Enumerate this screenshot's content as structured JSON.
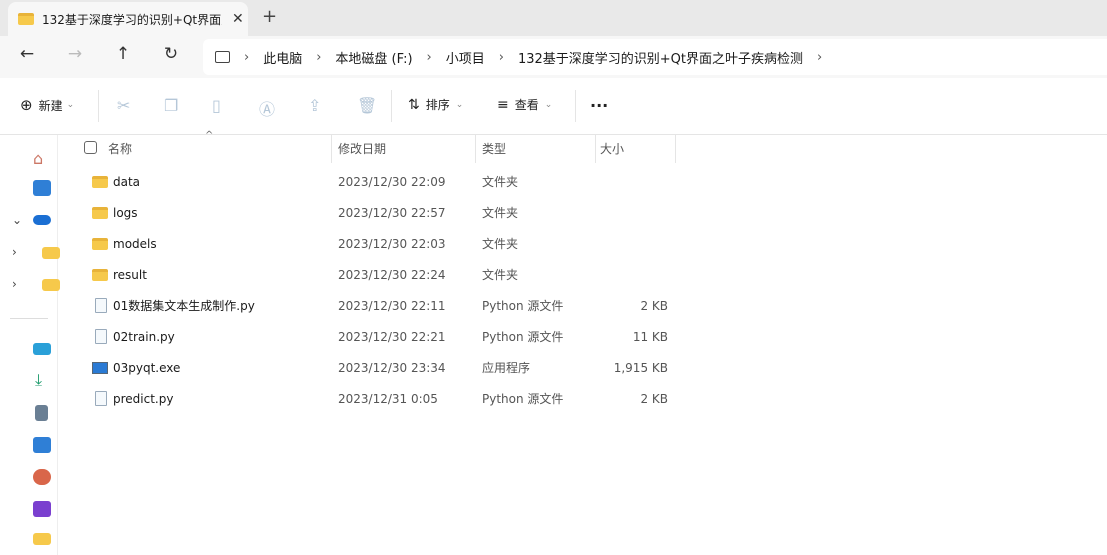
{
  "tab": {
    "title": "132基于深度学习的识别+Qt界面之叶子疾病检测",
    "close": "✕",
    "new_tab": "+"
  },
  "nav": {
    "back": "←",
    "forward": "→",
    "up": "↑",
    "refresh": "↻"
  },
  "breadcrumb": [
    "此电脑",
    "本地磁盘 (F:)",
    "小项目",
    "132基于深度学习的识别+Qt界面之叶子疾病检测"
  ],
  "toolbar": {
    "new_label": "新建",
    "sort_label": "排序",
    "view_label": "查看",
    "more": "···"
  },
  "columns": {
    "name": "名称",
    "modified": "修改日期",
    "type": "类型",
    "size": "大小"
  },
  "files": [
    {
      "name": "data",
      "modified": "2023/12/30 22:09",
      "type": "文件夹",
      "size": "",
      "icon": "folder"
    },
    {
      "name": "logs",
      "modified": "2023/12/30 22:57",
      "type": "文件夹",
      "size": "",
      "icon": "folder"
    },
    {
      "name": "models",
      "modified": "2023/12/30 22:03",
      "type": "文件夹",
      "size": "",
      "icon": "folder"
    },
    {
      "name": "result",
      "modified": "2023/12/30 22:24",
      "type": "文件夹",
      "size": "",
      "icon": "folder"
    },
    {
      "name": "01数据集文本生成制作.py",
      "modified": "2023/12/30 22:11",
      "type": "Python 源文件",
      "size": "2 KB",
      "icon": "python-file"
    },
    {
      "name": "02train.py",
      "modified": "2023/12/30 22:21",
      "type": "Python 源文件",
      "size": "11 KB",
      "icon": "python-file"
    },
    {
      "name": "03pyqt.exe",
      "modified": "2023/12/30 23:34",
      "type": "应用程序",
      "size": "1,915 KB",
      "icon": "exe"
    },
    {
      "name": "predict.py",
      "modified": "2023/12/31 0:05",
      "type": "Python 源文件",
      "size": "2 KB",
      "icon": "python-file"
    }
  ]
}
